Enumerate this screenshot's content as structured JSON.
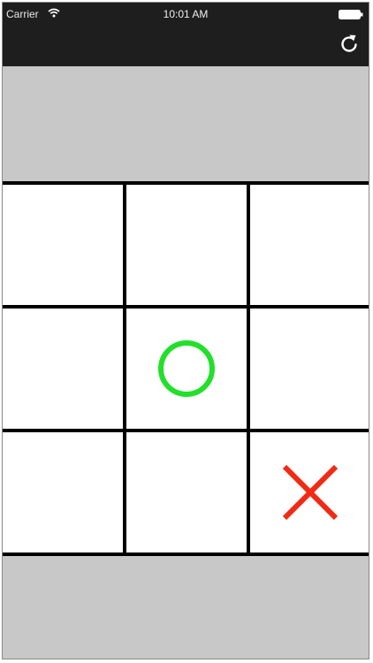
{
  "status_bar": {
    "carrier": "Carrier",
    "time": "10:01 AM",
    "wifi_icon": "wifi-icon",
    "battery_icon": "battery-icon"
  },
  "toolbar": {
    "refresh_icon": "refresh-icon"
  },
  "colors": {
    "topbar": "#1e1e1e",
    "background": "#c8c8c8",
    "grid_lines": "#000000",
    "cell": "#ffffff",
    "o_mark": "#22e02a",
    "x_mark": "#f02a14"
  },
  "board": {
    "rows": 3,
    "cols": 3,
    "cells": [
      "",
      "",
      "",
      "",
      "O",
      "",
      "",
      "",
      "X"
    ]
  }
}
